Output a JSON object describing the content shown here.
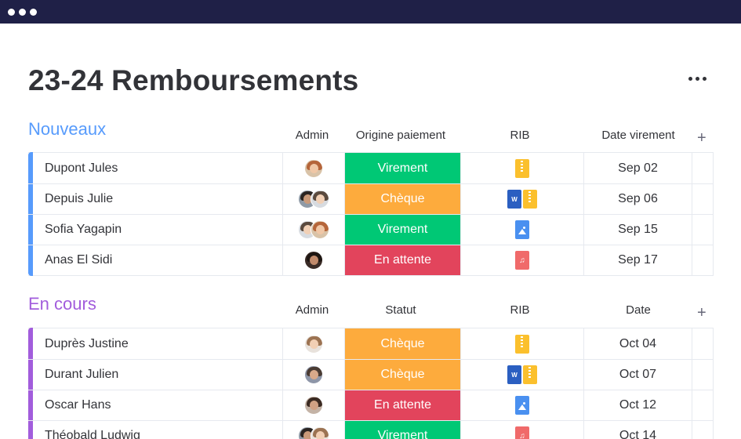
{
  "window": {
    "title": "23-24 Remboursements"
  },
  "colors": {
    "green": "#00c875",
    "orange": "#fdab3d",
    "red": "#e2445c",
    "blue": "#579bfc",
    "purple": "#a25ddc"
  },
  "groups": [
    {
      "title": "Nouveaux",
      "color": "#579bfc",
      "columns": {
        "admin": "Admin",
        "status": "Origine paiement",
        "rib": "RIB",
        "date": "Date virement"
      },
      "rows": [
        {
          "name": "Dupont Jules",
          "admins": [
            "avatar-woman-red-hair"
          ],
          "status": "Virement",
          "status_color": "#00c875",
          "rib": [
            "zip-file-icon"
          ],
          "date": "Sep 02"
        },
        {
          "name": "Depuis Julie",
          "admins": [
            "avatar-man-dark",
            "avatar-man-light"
          ],
          "status": "Chèque",
          "status_color": "#fdab3d",
          "rib": [
            "word-file-icon",
            "zip-file-icon"
          ],
          "date": "Sep 06"
        },
        {
          "name": "Sofia Yagapin",
          "admins": [
            "avatar-man-light",
            "avatar-woman-red-hair"
          ],
          "status": "Virement",
          "status_color": "#00c875",
          "rib": [
            "image-file-icon"
          ],
          "date": "Sep 15"
        },
        {
          "name": "Anas El Sidi",
          "admins": [
            "avatar-woman-dark"
          ],
          "status": "En attente",
          "status_color": "#e2445c",
          "rib": [
            "audio-file-icon"
          ],
          "date": "Sep 17"
        }
      ]
    },
    {
      "title": "En cours",
      "color": "#a25ddc",
      "columns": {
        "admin": "Admin",
        "status": "Statut",
        "rib": "RIB",
        "date": "Date"
      },
      "rows": [
        {
          "name": "Duprès Justine",
          "admins": [
            "avatar-woman-light"
          ],
          "status": "Chèque",
          "status_color": "#fdab3d",
          "rib": [
            "zip-file-icon"
          ],
          "date": "Oct 04"
        },
        {
          "name": "Durant Julien",
          "admins": [
            "avatar-man-beard"
          ],
          "status": "Chèque",
          "status_color": "#fdab3d",
          "rib": [
            "word-file-icon",
            "zip-file-icon"
          ],
          "date": "Oct 07"
        },
        {
          "name": "Oscar Hans",
          "admins": [
            "avatar-woman-brown"
          ],
          "status": "En attente",
          "status_color": "#e2445c",
          "rib": [
            "image-file-icon"
          ],
          "date": "Oct 12"
        },
        {
          "name": "Théobald Ludwig",
          "admins": [
            "avatar-man-dark",
            "avatar-woman-light"
          ],
          "status": "Virement",
          "status_color": "#00c875",
          "rib": [
            "audio-file-icon"
          ],
          "date": "Oct 14"
        }
      ]
    }
  ],
  "icons": {
    "more": "more-options-icon",
    "add_column": "plus-icon",
    "word_label": "W"
  }
}
